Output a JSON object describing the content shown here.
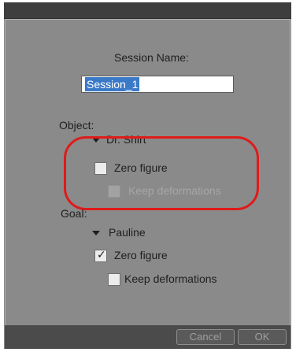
{
  "session": {
    "label": "Session Name:",
    "value": "Session_1"
  },
  "object": {
    "heading": "Object:",
    "item": "Dr. Shirt",
    "zero_figure_label": "Zero figure",
    "zero_figure_checked": false,
    "keep_deformations_label": "Keep deformations",
    "keep_deformations_checked": false,
    "keep_deformations_enabled": false
  },
  "goal": {
    "heading": "Goal:",
    "item": "Pauline",
    "zero_figure_label": "Zero figure",
    "zero_figure_checked": true,
    "keep_deformations_label": "Keep deformations",
    "keep_deformations_checked": false
  },
  "buttons": {
    "cancel": "Cancel",
    "ok": "OK"
  },
  "colors": {
    "dialog_bg": "#8a8a8a",
    "titlebar": "#3e3e3e",
    "highlight_annotation": "#e01a1a",
    "selection": "#3a79c8"
  },
  "icons": {
    "expand": "triangle-down-icon",
    "check": "checkmark-icon"
  }
}
